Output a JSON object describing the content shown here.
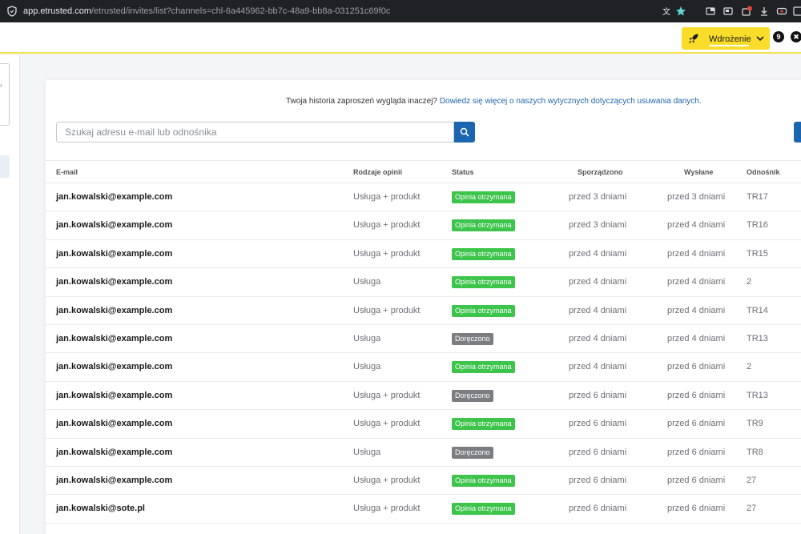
{
  "browser": {
    "url_domain": "app.etrusted.com",
    "url_path": "/etrusted/invites/list?channels=chl-6a445962-bb7c-48a9-bb8a-031251c69f0c"
  },
  "topbar": {
    "deploy_label": "Wdrożenie",
    "icon_left": "9",
    "icon_right": "✖"
  },
  "notice": {
    "text": "Twoja historia zaproszeń wygląda inaczej?",
    "link": "Dowiedz się więcej o naszych wytycznych dotyczących usuwania danych."
  },
  "search": {
    "placeholder": "Szukaj adresu e-mail lub odnośnika",
    "value": ""
  },
  "table": {
    "headers": {
      "email": "E-mail",
      "types": "Rodzaje opinii",
      "status": "Status",
      "made": "Sporządzono",
      "sent": "Wysłane",
      "link": "Odnośnik"
    },
    "rows": [
      {
        "email": "jan.kowalski@example.com",
        "types": "Usługa + produkt",
        "status": "Opinia otrzymana",
        "status_kind": "green",
        "made": "przed 3 dniami",
        "sent": "przed 3 dniami",
        "link": "TR17"
      },
      {
        "email": "jan.kowalski@example.com",
        "types": "Usługa + produkt",
        "status": "Opinia otrzymana",
        "status_kind": "green",
        "made": "przed 3 dniami",
        "sent": "przed 4 dniami",
        "link": "TR16"
      },
      {
        "email": "jan.kowalski@example.com",
        "types": "Usługa + produkt",
        "status": "Opinia otrzymana",
        "status_kind": "green",
        "made": "przed 4 dniami",
        "sent": "przed 4 dniami",
        "link": "TR15"
      },
      {
        "email": "jan.kowalski@example.com",
        "types": "Usługa",
        "status": "Opinia otrzymana",
        "status_kind": "green",
        "made": "przed 4 dniami",
        "sent": "przed 4 dniami",
        "link": "2"
      },
      {
        "email": "jan.kowalski@example.com",
        "types": "Usługa + produkt",
        "status": "Opinia otrzymana",
        "status_kind": "green",
        "made": "przed 4 dniami",
        "sent": "przed 4 dniami",
        "link": "TR14"
      },
      {
        "email": "jan.kowalski@example.com",
        "types": "Usługa",
        "status": "Doręczono",
        "status_kind": "gray",
        "made": "przed 4 dniami",
        "sent": "przed 4 dniami",
        "link": "TR13"
      },
      {
        "email": "jan.kowalski@example.com",
        "types": "Usługa",
        "status": "Opinia otrzymana",
        "status_kind": "green",
        "made": "przed 4 dniami",
        "sent": "przed 6 dniami",
        "link": "2"
      },
      {
        "email": "jan.kowalski@example.com",
        "types": "Usługa + produkt",
        "status": "Doręczono",
        "status_kind": "gray",
        "made": "przed 6 dniami",
        "sent": "przed 6 dniami",
        "link": "TR13"
      },
      {
        "email": "jan.kowalski@example.com",
        "types": "Usługa + produkt",
        "status": "Opinia otrzymana",
        "status_kind": "green",
        "made": "przed 6 dniami",
        "sent": "przed 6 dniami",
        "link": "TR9"
      },
      {
        "email": "jan.kowalski@example.com",
        "types": "Usługa",
        "status": "Doręczono",
        "status_kind": "gray",
        "made": "przed 6 dniami",
        "sent": "przed 6 dniami",
        "link": "TR8"
      },
      {
        "email": "jan.kowalski@example.com",
        "types": "Usługa + produkt",
        "status": "Opinia otrzymana",
        "status_kind": "green",
        "made": "przed 6 dniami",
        "sent": "przed 6 dniami",
        "link": "27"
      },
      {
        "email": "jan.kowalski@sote.pl",
        "types": "Usługa + produkt",
        "status": "Opinia otrzymana",
        "status_kind": "green",
        "made": "przed 6 dniami",
        "sent": "przed 6 dniami",
        "link": "27"
      }
    ]
  },
  "colors": {
    "accent": "#1c66b0",
    "deploy_yellow": "#f9dd2a",
    "status_green": "#3cc44b",
    "status_gray": "#7b7d80"
  }
}
